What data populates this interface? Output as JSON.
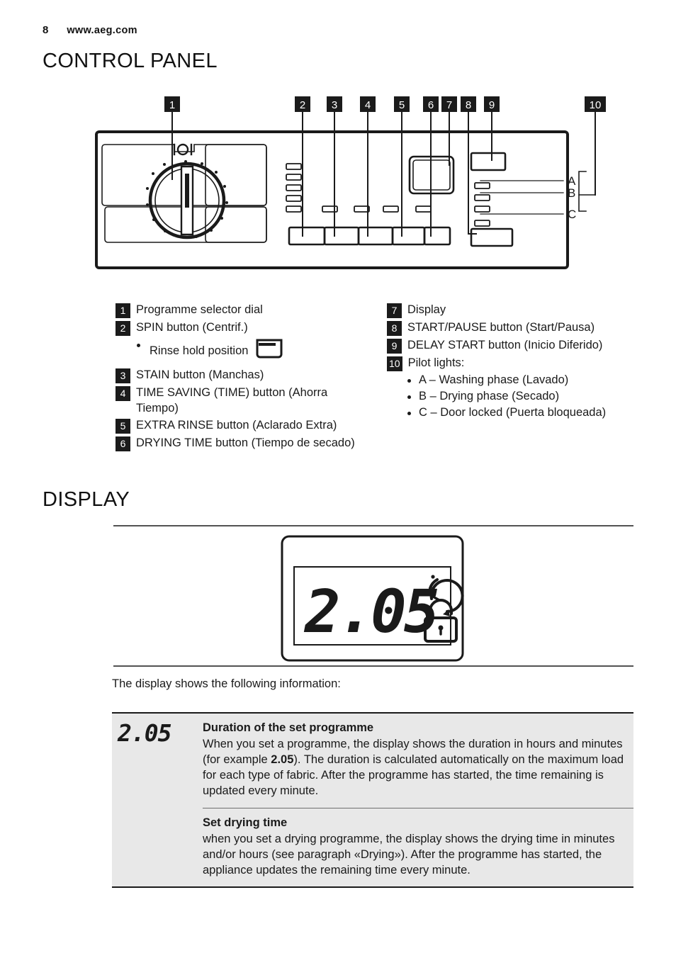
{
  "page": {
    "number": "8",
    "site": "www.aeg.com"
  },
  "headings": {
    "control_panel": "CONTROL PANEL",
    "display": "DISPLAY"
  },
  "panel_callouts": {
    "numbers": [
      "1",
      "2",
      "3",
      "4",
      "5",
      "6",
      "7",
      "8",
      "9",
      "10"
    ],
    "pilot_light_labels": [
      "A",
      "B",
      "C"
    ]
  },
  "legend_left": [
    {
      "num": "1",
      "text": "Programme selector dial"
    },
    {
      "num": "2",
      "text": "SPIN button (Centrif.)",
      "sub_bullet": "Rinse hold position",
      "sub_icon": "rinse-hold-tub-icon"
    },
    {
      "num": "3",
      "text": "STAIN button (Manchas)"
    },
    {
      "num": "4",
      "text": "TIME SAVING (TIME) button (Ahorra Tiempo)"
    },
    {
      "num": "5",
      "text": "EXTRA RINSE button (Aclarado Extra)"
    },
    {
      "num": "6",
      "text": "DRYING TIME button (Tiempo de secado)"
    }
  ],
  "legend_right": [
    {
      "num": "7",
      "text": "Display"
    },
    {
      "num": "8",
      "text": "START/PAUSE button (Start/Pausa)"
    },
    {
      "num": "9",
      "text": "DELAY START button (Inicio Diferido)"
    },
    {
      "num": "10",
      "text": "Pilot lights:",
      "bullets": [
        "A – Washing phase (Lavado)",
        "B – Drying phase (Secado)",
        "C – Door locked (Puerta bloqueada)"
      ]
    }
  ],
  "display_figure": {
    "value": "2.05",
    "icons": [
      "delay-start-clock-icon",
      "door-lock-icon"
    ]
  },
  "display_intro": "The display shows the following information:",
  "info_table": [
    {
      "icon_value": "2.05",
      "title": "Duration of the set programme",
      "body_1": "When you set a programme, the display shows the duration in hours and minutes (for example ",
      "body_bold": "2.05",
      "body_2": ").",
      "body_3": "The duration is calculated automatically on the maximum load for each type of fabric.",
      "body_4": "After the programme has started, the time remaining is updated every minute."
    },
    {
      "title": "Set drying time",
      "body_1": "when you set a drying programme, the display shows the drying time in minutes and/or hours (see paragraph «Drying»).",
      "body_2": "After the programme has started, the appliance updates the remaining time every minute."
    }
  ],
  "colors": {
    "ink": "#1a1a1a",
    "badge_bg": "#1b1b1b",
    "table_bg": "#e8e8e8"
  }
}
